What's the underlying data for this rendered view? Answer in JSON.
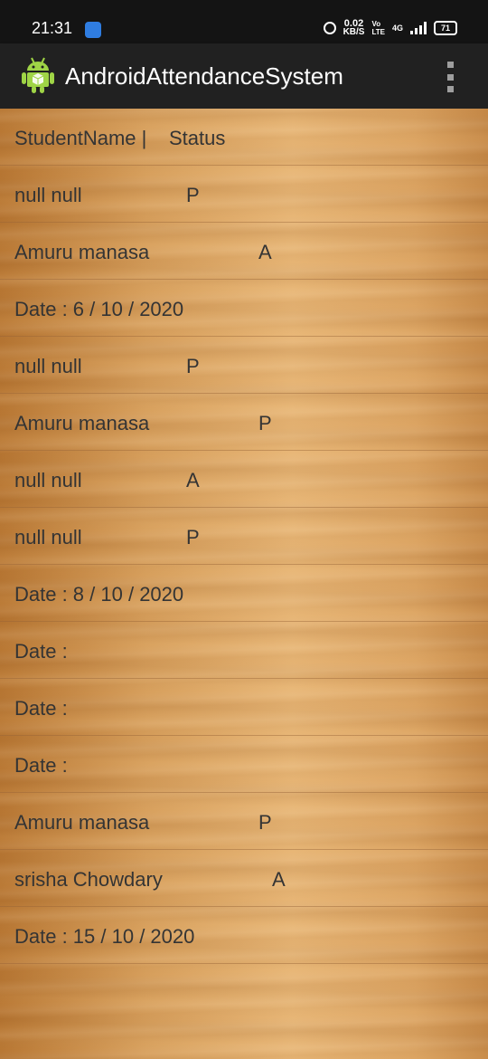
{
  "status_bar": {
    "time": "21:31",
    "speed_value": "0.02",
    "speed_unit": "KB/S",
    "volte_top": "Vo",
    "volte_bottom": "LTE",
    "network": "4G",
    "battery": "71"
  },
  "app_bar": {
    "title": "AndroidAttendanceSystem",
    "logo_icon": "android-logo-icon",
    "menu_icon": "overflow-menu-icon"
  },
  "list": {
    "header": {
      "name": "StudentName |",
      "status": "Status"
    },
    "rows": [
      {
        "name": "null null",
        "status": "P"
      },
      {
        "name": "Amuru manasa",
        "status": "A"
      },
      {
        "name": "Date : 6 / 10 / 2020",
        "status": ""
      },
      {
        "name": "null null",
        "status": "P"
      },
      {
        "name": "Amuru manasa",
        "status": "P"
      },
      {
        "name": "null null",
        "status": "A"
      },
      {
        "name": "null null",
        "status": "P"
      },
      {
        "name": "Date : 8 / 10 / 2020",
        "status": ""
      },
      {
        "name": "Date :",
        "status": ""
      },
      {
        "name": "Date :",
        "status": ""
      },
      {
        "name": "Date :",
        "status": ""
      },
      {
        "name": "Amuru manasa",
        "status": "P"
      },
      {
        "name": "srisha Chowdary",
        "status": "A"
      },
      {
        "name": "Date : 15 / 10 / 2020",
        "status": ""
      }
    ]
  }
}
